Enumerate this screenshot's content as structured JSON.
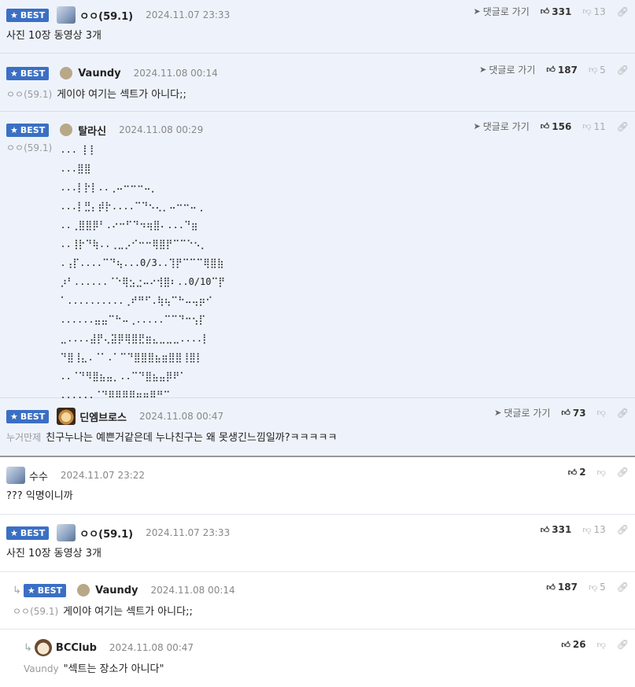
{
  "best_comments": [
    {
      "badge": "BEST",
      "nick": "ㅇㅇ(59.1)",
      "date": "2024.11.07 23:33",
      "reply_link": "댓글로 가기",
      "likes": "331",
      "dislikes": "13",
      "text": "사진 10장 동영상 3개"
    },
    {
      "badge": "BEST",
      "nick": "Vaundy",
      "date": "2024.11.08 00:14",
      "reply_link": "댓글로 가기",
      "likes": "187",
      "dislikes": "5",
      "mention": "ㅇㅇ(59.1)",
      "text": "게이야 여기는 섹트가 아니다;;"
    },
    {
      "badge": "BEST",
      "nick": "탈라신",
      "date": "2024.11.08 00:29",
      "reply_link": "댓글로 가기",
      "likes": "156",
      "dislikes": "11",
      "mention": "ㅇㅇ(59.1)",
      "art": "... ⡇⡇\n...⣿⣿\n...⡇⡗⡇..⢀⠤⠒⠒⠒⠤⡀\n...⡇⣛⡄⡾⡗....⠉⠙⠢⢄⡀⠤⠒⠒⠤⢀\n..⢀⣿⣿⡿⠃.⠔⠒⠋⠙⠲⢶⣿⠄...⠙⣶\n..⢸⡗⠙⢷..⢀⣀⡠⠊⠒⠒⢿⣿⡟⠉⠉⠑⠢⡀\n.⢠⡏....⠉⠙⢦...0/3..⢹⡟⠉⠉⠉⢿⣿⣷\n⡰⠃......⠈⠑⢿⣢⣐⠤⠔⢺⣿⠆..0/10⠉⡟\n⠁..........⢀⠞⠛⠋.⢷⢦⠉⠓⠤⢤⡶⠊\n......⣤⣤⠉⠓⠤⢀.....⠉⠉⠙⠒⢢⡏\n⣀....⣼⡟⢄⣽⡿⢿⣿⣟⣶⣄⣀⣀⣀....⡇\n⠙⣿⢸⣄.⠈⠁.⠁⠉⠙⣿⣿⣿⣦⣶⣿⣿⢸⣿⡇\n..⠈⠙⠻⣿⣦⣤⡀..⠉⠙⣿⣦⣤⡿⠟⠁\n......⠈⠙⠿⠿⢿⣿⣶⣶⡿⠛⠉\n..............⠘⢳"
    },
    {
      "badge": "BEST",
      "nick": "딘엠브로스",
      "date": "2024.11.08 00:47",
      "reply_link": "댓글로 가기",
      "likes": "73",
      "dislikes": "",
      "mention": "누거만제",
      "text": "친구누나는 예쁜거같은데 누나친구는 왜 못생긴느낌일까?ㅋㅋㅋㅋㅋ"
    }
  ],
  "comments": [
    {
      "nick": "수수",
      "date": "2024.11.07 23:22",
      "likes": "2",
      "text": "??? 익명이니까"
    },
    {
      "badge": "BEST",
      "nick": "ㅇㅇ(59.1)",
      "date": "2024.11.07 23:33",
      "likes": "331",
      "dislikes": "13",
      "text": "사진 10장 동영상 3개"
    },
    {
      "badge": "BEST",
      "nick": "Vaundy",
      "date": "2024.11.08 00:14",
      "likes": "187",
      "dislikes": "5",
      "mention": "ㅇㅇ(59.1)",
      "text": "게이야 여기는 섹트가 아니다;;"
    },
    {
      "nick": "BCClub",
      "date": "2024.11.08 00:47",
      "likes": "26",
      "mention": "Vaundy",
      "text": "\"섹트는 장소가 아니다\""
    }
  ]
}
